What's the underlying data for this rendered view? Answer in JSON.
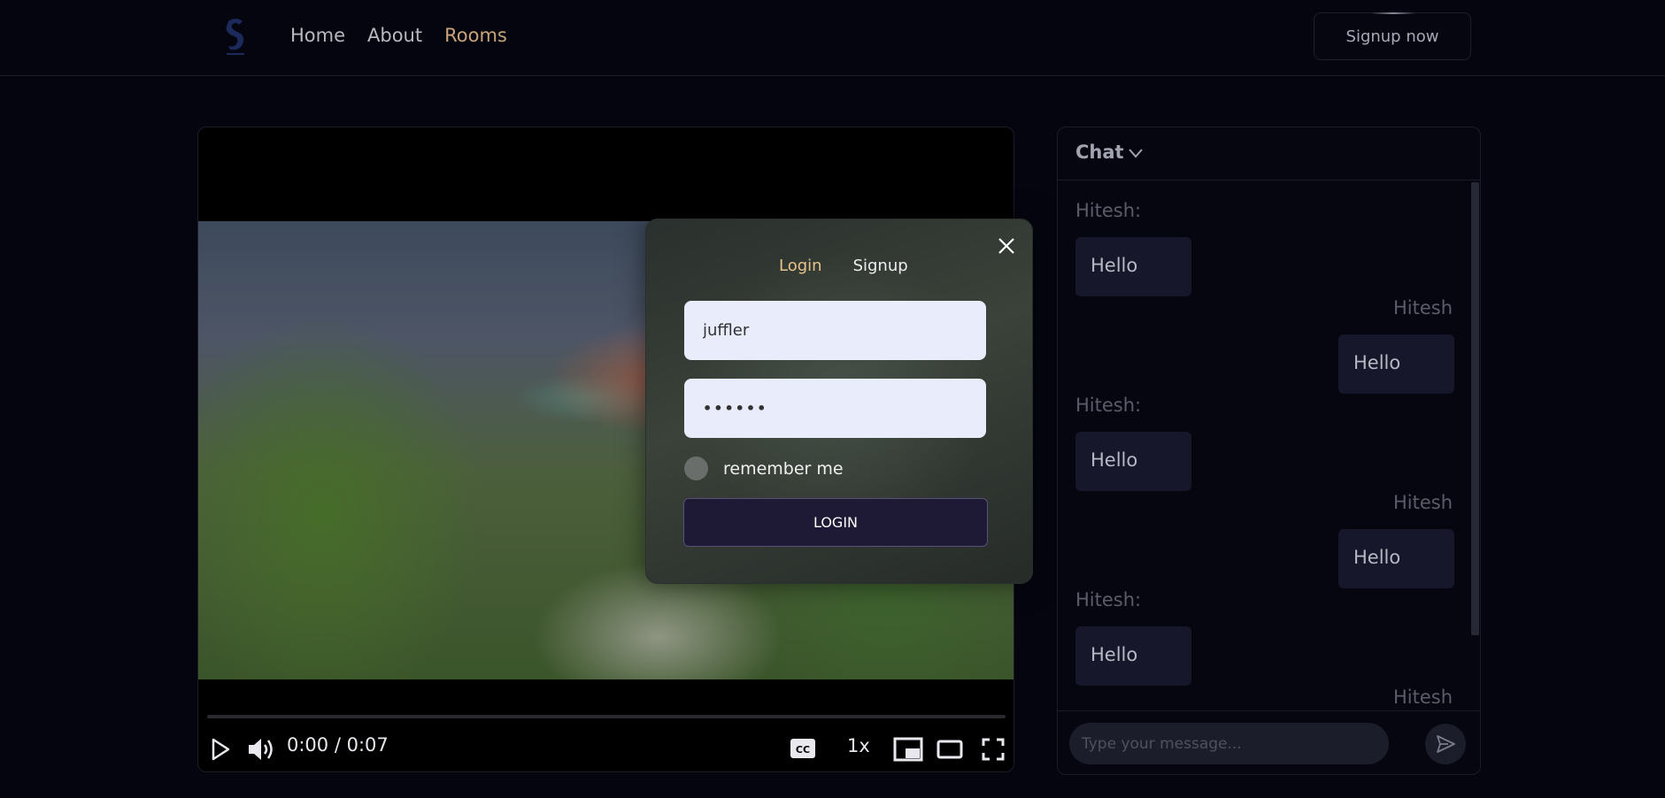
{
  "header": {
    "nav": [
      {
        "label": "Home"
      },
      {
        "label": "About"
      },
      {
        "label": "Rooms"
      }
    ],
    "signup_label": "Signup now",
    "accent_color": "#c9a37a"
  },
  "video": {
    "time_display": "0:00 / 0:07",
    "current_time": "0:00",
    "duration": "0:07",
    "progress": 0,
    "speed_label": "1x",
    "icons": [
      "play-icon",
      "volume-icon",
      "captions-icon",
      "mini-player-icon",
      "theater-mode-icon",
      "fullscreen-icon"
    ]
  },
  "modal": {
    "tabs": [
      {
        "label": "Login",
        "active": true
      },
      {
        "label": "Signup",
        "active": false
      }
    ],
    "username_value": "juffler",
    "password_value": "••••••",
    "remember_label": "remember me",
    "login_label": "LOGIN",
    "active_tab_color": "#e8c28a"
  },
  "chat": {
    "title": "Chat",
    "messages": [
      {
        "sender": "Hitesh:",
        "text": "Hello",
        "side": "left"
      },
      {
        "sender": "Hitesh",
        "text": "Hello",
        "side": "right"
      },
      {
        "sender": "Hitesh:",
        "text": "Hello",
        "side": "left"
      },
      {
        "sender": "Hitesh",
        "text": "Hello",
        "side": "right"
      },
      {
        "sender": "Hitesh:",
        "text": "Hello",
        "side": "left"
      },
      {
        "sender": "Hitesh",
        "text": "",
        "side": "right"
      }
    ],
    "input_placeholder": "Type your message..."
  }
}
